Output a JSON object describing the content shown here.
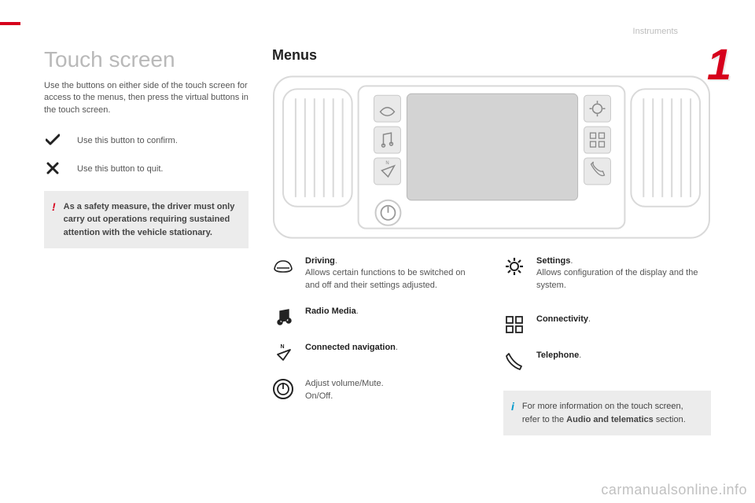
{
  "header": {
    "section": "Instruments",
    "chapter": "1"
  },
  "left": {
    "title": "Touch screen",
    "intro": "Use the buttons on either side of the touch screen for access to the menus, then press the virtual buttons in the touch screen.",
    "confirm": "Use this button to confirm.",
    "quit": "Use this button to quit.",
    "warning": "As a safety measure, the driver must only carry out operations requiring sustained attention with the vehicle stationary."
  },
  "right": {
    "heading": "Menus",
    "items_left": [
      {
        "label": "Driving",
        "desc": "Allows certain functions to be switched on and off and their settings adjusted."
      },
      {
        "label": "Radio Media",
        "desc": ""
      },
      {
        "label": "Connected navigation",
        "desc": ""
      },
      {
        "label": "",
        "desc": "Adjust volume/Mute.\nOn/Off."
      }
    ],
    "items_right": [
      {
        "label": "Settings",
        "desc": "Allows configuration of the display and the system."
      },
      {
        "label": "Connectivity",
        "desc": ""
      },
      {
        "label": "Telephone",
        "desc": ""
      }
    ],
    "info": {
      "prefix": "For more information on the touch screen, refer to the ",
      "bold": "Audio and telematics",
      "suffix": " section."
    }
  },
  "watermark": "carmanualsonline.info"
}
